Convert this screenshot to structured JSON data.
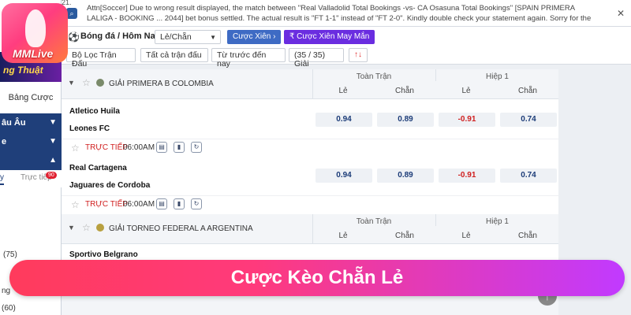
{
  "logo": {
    "brand": "MMLive"
  },
  "promo": {
    "text": "ng Thuật"
  },
  "left": {
    "bang_cuoc": "Bảng Cược",
    "nav": [
      {
        "label": "âu Âu"
      },
      {
        "label": "e"
      },
      {
        "label": ""
      }
    ],
    "tab_today": "y",
    "tab_live": "Trực tiếp",
    "live_badge": "90",
    "counts": [
      "(75)",
      "ng",
      "(60)"
    ]
  },
  "topbar": {
    "date_fragment": "21.",
    "ticker": "Attn[Soccer] Due to wrong result displayed, the match between \"Real Valladolid Total Bookings -vs- CA Osasuna Total Bookings\" [SPAIN PRIMERA LALIGA - BOOKING ... 2044] bet bonus settled. The actual result is \"FT 1-1\" instead of \"FT 2-0\". Kindly double check your statement again. Sorry for the",
    "close": "✕"
  },
  "filters": {
    "crumb": "Bóng đá / Hôm Nay",
    "market": "Lẻ/Chẵn",
    "btn_parlay": "Cược Xiên",
    "btn_lucky": "Cược Xiên May Mắn",
    "match_filter": "Bộ Lọc Trận Đấu",
    "all_matches": "Tất cả trận đấu",
    "time_order": "Từ trước đến nay",
    "count": "(35 / 35) Giải",
    "sort_icon": "↑↓"
  },
  "headers": {
    "full": "Toàn Trận",
    "half": "Hiệp 1",
    "odd": "Lẻ",
    "even": "Chẵn"
  },
  "leagues": [
    {
      "name": "GIẢI PRIMERA B COLOMBIA"
    },
    {
      "name": "GIẢI TORNEO FEDERAL A ARGENTINA"
    }
  ],
  "matches": [
    {
      "home": "Atletico Huila",
      "away": "Leones FC",
      "odds": [
        "0.94",
        "0.89",
        "-0.91",
        "0.74"
      ],
      "live": "TRỰC TIẾP",
      "time": "06:00AM"
    },
    {
      "home": "Real Cartagena",
      "away": "Jaguares de Cordoba",
      "odds": [
        "0.94",
        "0.89",
        "-0.91",
        "0.74"
      ],
      "live": "TRỰC TIẾP",
      "time": "06:00AM"
    },
    {
      "home": "Sportivo Belgrano",
      "away": "",
      "odds": [],
      "live": "",
      "time": ""
    }
  ],
  "banner": {
    "text": "Cược Kèo Chẵn Lẻ"
  },
  "colors": {
    "nav_blue": "#1f3f7a",
    "odds_blue": "#1c3c78",
    "odds_red": "#d02020",
    "banner_start": "#ff3b5c",
    "banner_end": "#c13aff"
  }
}
